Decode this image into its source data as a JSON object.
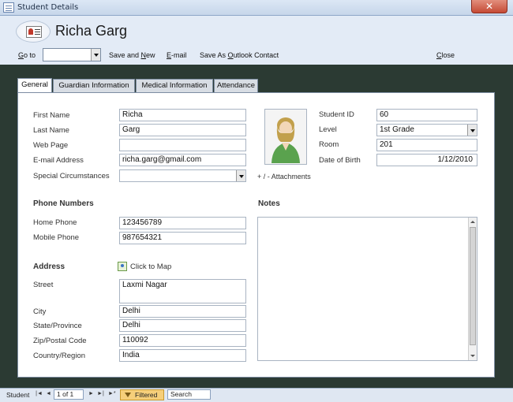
{
  "window": {
    "title": "Student Details",
    "close_label": "✕"
  },
  "header": {
    "student_name": "Richa Garg",
    "toolbar": {
      "goto_label": "Go to",
      "goto_value": "",
      "save_new_label": "Save and New",
      "email_label": "E-mail",
      "save_outlook_label": "Save As Outlook Contact",
      "close_label": "Close"
    }
  },
  "tabs": [
    {
      "label": "General",
      "active": true
    },
    {
      "label": "Guardian Information",
      "active": false
    },
    {
      "label": "Medical Information",
      "active": false
    },
    {
      "label": "Attendance",
      "active": false
    }
  ],
  "general": {
    "first_name_label": "First Name",
    "first_name": "Richa",
    "last_name_label": "Last Name",
    "last_name": "Garg",
    "web_page_label": "Web Page",
    "web_page": "",
    "email_label": "E-mail Address",
    "email": "richa.garg@gmail.com",
    "special_label": "Special Circumstances",
    "special": "",
    "student_id_label": "Student ID",
    "student_id": "60",
    "level_label": "Level",
    "level": "1st Grade",
    "room_label": "Room",
    "room": "201",
    "dob_label": "Date of Birth",
    "dob": "1/12/2010",
    "attachments_label": "+ / -  Attachments",
    "phone_section": "Phone Numbers",
    "home_phone_label": "Home Phone",
    "home_phone": "123456789",
    "mobile_phone_label": "Mobile Phone",
    "mobile_phone": "987654321",
    "notes_label": "Notes",
    "notes": "",
    "address_section": "Address",
    "click_to_map": "Click to Map",
    "street_label": "Street",
    "street": "Laxmi Nagar",
    "city_label": "City",
    "city": "Delhi",
    "state_label": "State/Province",
    "state": "Delhi",
    "zip_label": "Zip/Postal Code",
    "zip": "110092",
    "country_label": "Country/Region",
    "country": "India"
  },
  "statusbar": {
    "record_label": "Student",
    "record_value": "1 of 1",
    "filtered_label": "Filtered",
    "search_label": "Search"
  },
  "icons": {
    "app": "form-icon",
    "student": "student-card-icon",
    "photo": "person-photo-icon",
    "map": "map-icon",
    "filter": "filter-icon"
  }
}
